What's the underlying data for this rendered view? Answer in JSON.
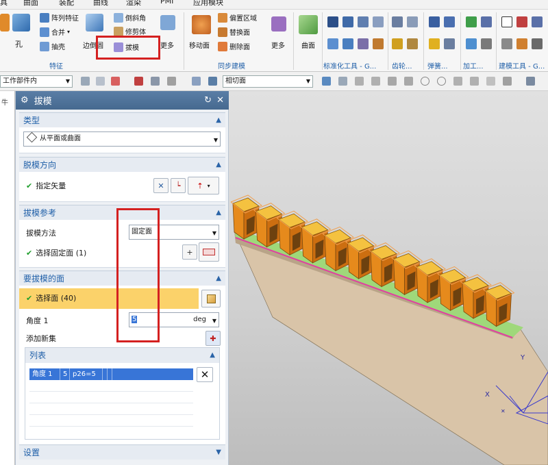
{
  "menu": [
    "具",
    "曲面",
    "装配",
    "曲线",
    "渲染",
    "PMI",
    "应用模块"
  ],
  "ribbon": {
    "kong_label": "孔",
    "array_feature": "阵列特征",
    "merge": "合并",
    "shell": "抽壳",
    "edge_blend": "边倒圆",
    "chamfer": "倒斜角",
    "trim_body": "修剪体",
    "draft": "拔模",
    "more1": "更多",
    "move_face": "移动面",
    "offset_region": "偏置区域",
    "replace_face": "替换面",
    "delete_face": "删除面",
    "more2": "更多",
    "surface": "曲面",
    "group_feature": "特征",
    "group_sync": "同步建模",
    "group_std": "标准化工具 - G...",
    "group_gear": "齿轮...",
    "group_spring": "弹簧...",
    "group_process": "加工...",
    "group_model": "建模工具 - G..."
  },
  "toolbar": {
    "filter_scope": "工作部件内",
    "snap_face": "相切面"
  },
  "dialog": {
    "title": "拔模",
    "type_header": "类型",
    "type_value": "从平面或曲面",
    "dir_header": "脱模方向",
    "dir_label": "指定矢量",
    "ref_header": "拔模参考",
    "method_label": "拔模方法",
    "method_value": "固定面",
    "fixed_face_label": "选择固定面 (1)",
    "faces_header": "要拔模的面",
    "select_face_label": "选择面 (40)",
    "angle_label": "角度 1",
    "angle_value": "5",
    "angle_unit": "deg",
    "add_set_label": "添加新集",
    "list_header": "列表",
    "list_row": [
      "角度 1",
      "5",
      "p26=5"
    ],
    "settings_header": "设置"
  },
  "left_strip_label": "牛",
  "colors": {
    "accent": "#1f5fa8",
    "highlight_row": "#fbd26a",
    "part_orange": "#e68a1c",
    "plate": "#d9c4a8",
    "red_annotation": "#d42020"
  }
}
